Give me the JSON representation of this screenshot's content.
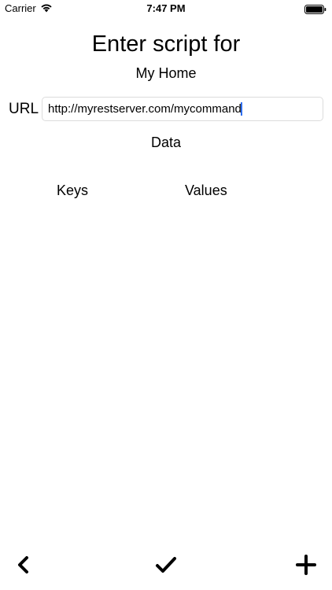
{
  "status_bar": {
    "carrier": "Carrier",
    "time": "7:47 PM",
    "icons": [
      "wifi-icon",
      "battery-icon"
    ]
  },
  "header": {
    "title": "Enter script for",
    "subtitle": "My Home"
  },
  "url_field": {
    "label": "URL",
    "value": "http://myrestserver.com/mycommand"
  },
  "data_section": {
    "label": "Data",
    "columns": {
      "keys": "Keys",
      "values": "Values"
    }
  },
  "toolbar": {
    "icons": [
      "back-chevron-icon",
      "checkmark-icon",
      "plus-icon"
    ]
  },
  "colors": {
    "text": "#000000",
    "background": "#ffffff",
    "caret": "#2f6ff0",
    "input_border": "#dcdcdc"
  }
}
